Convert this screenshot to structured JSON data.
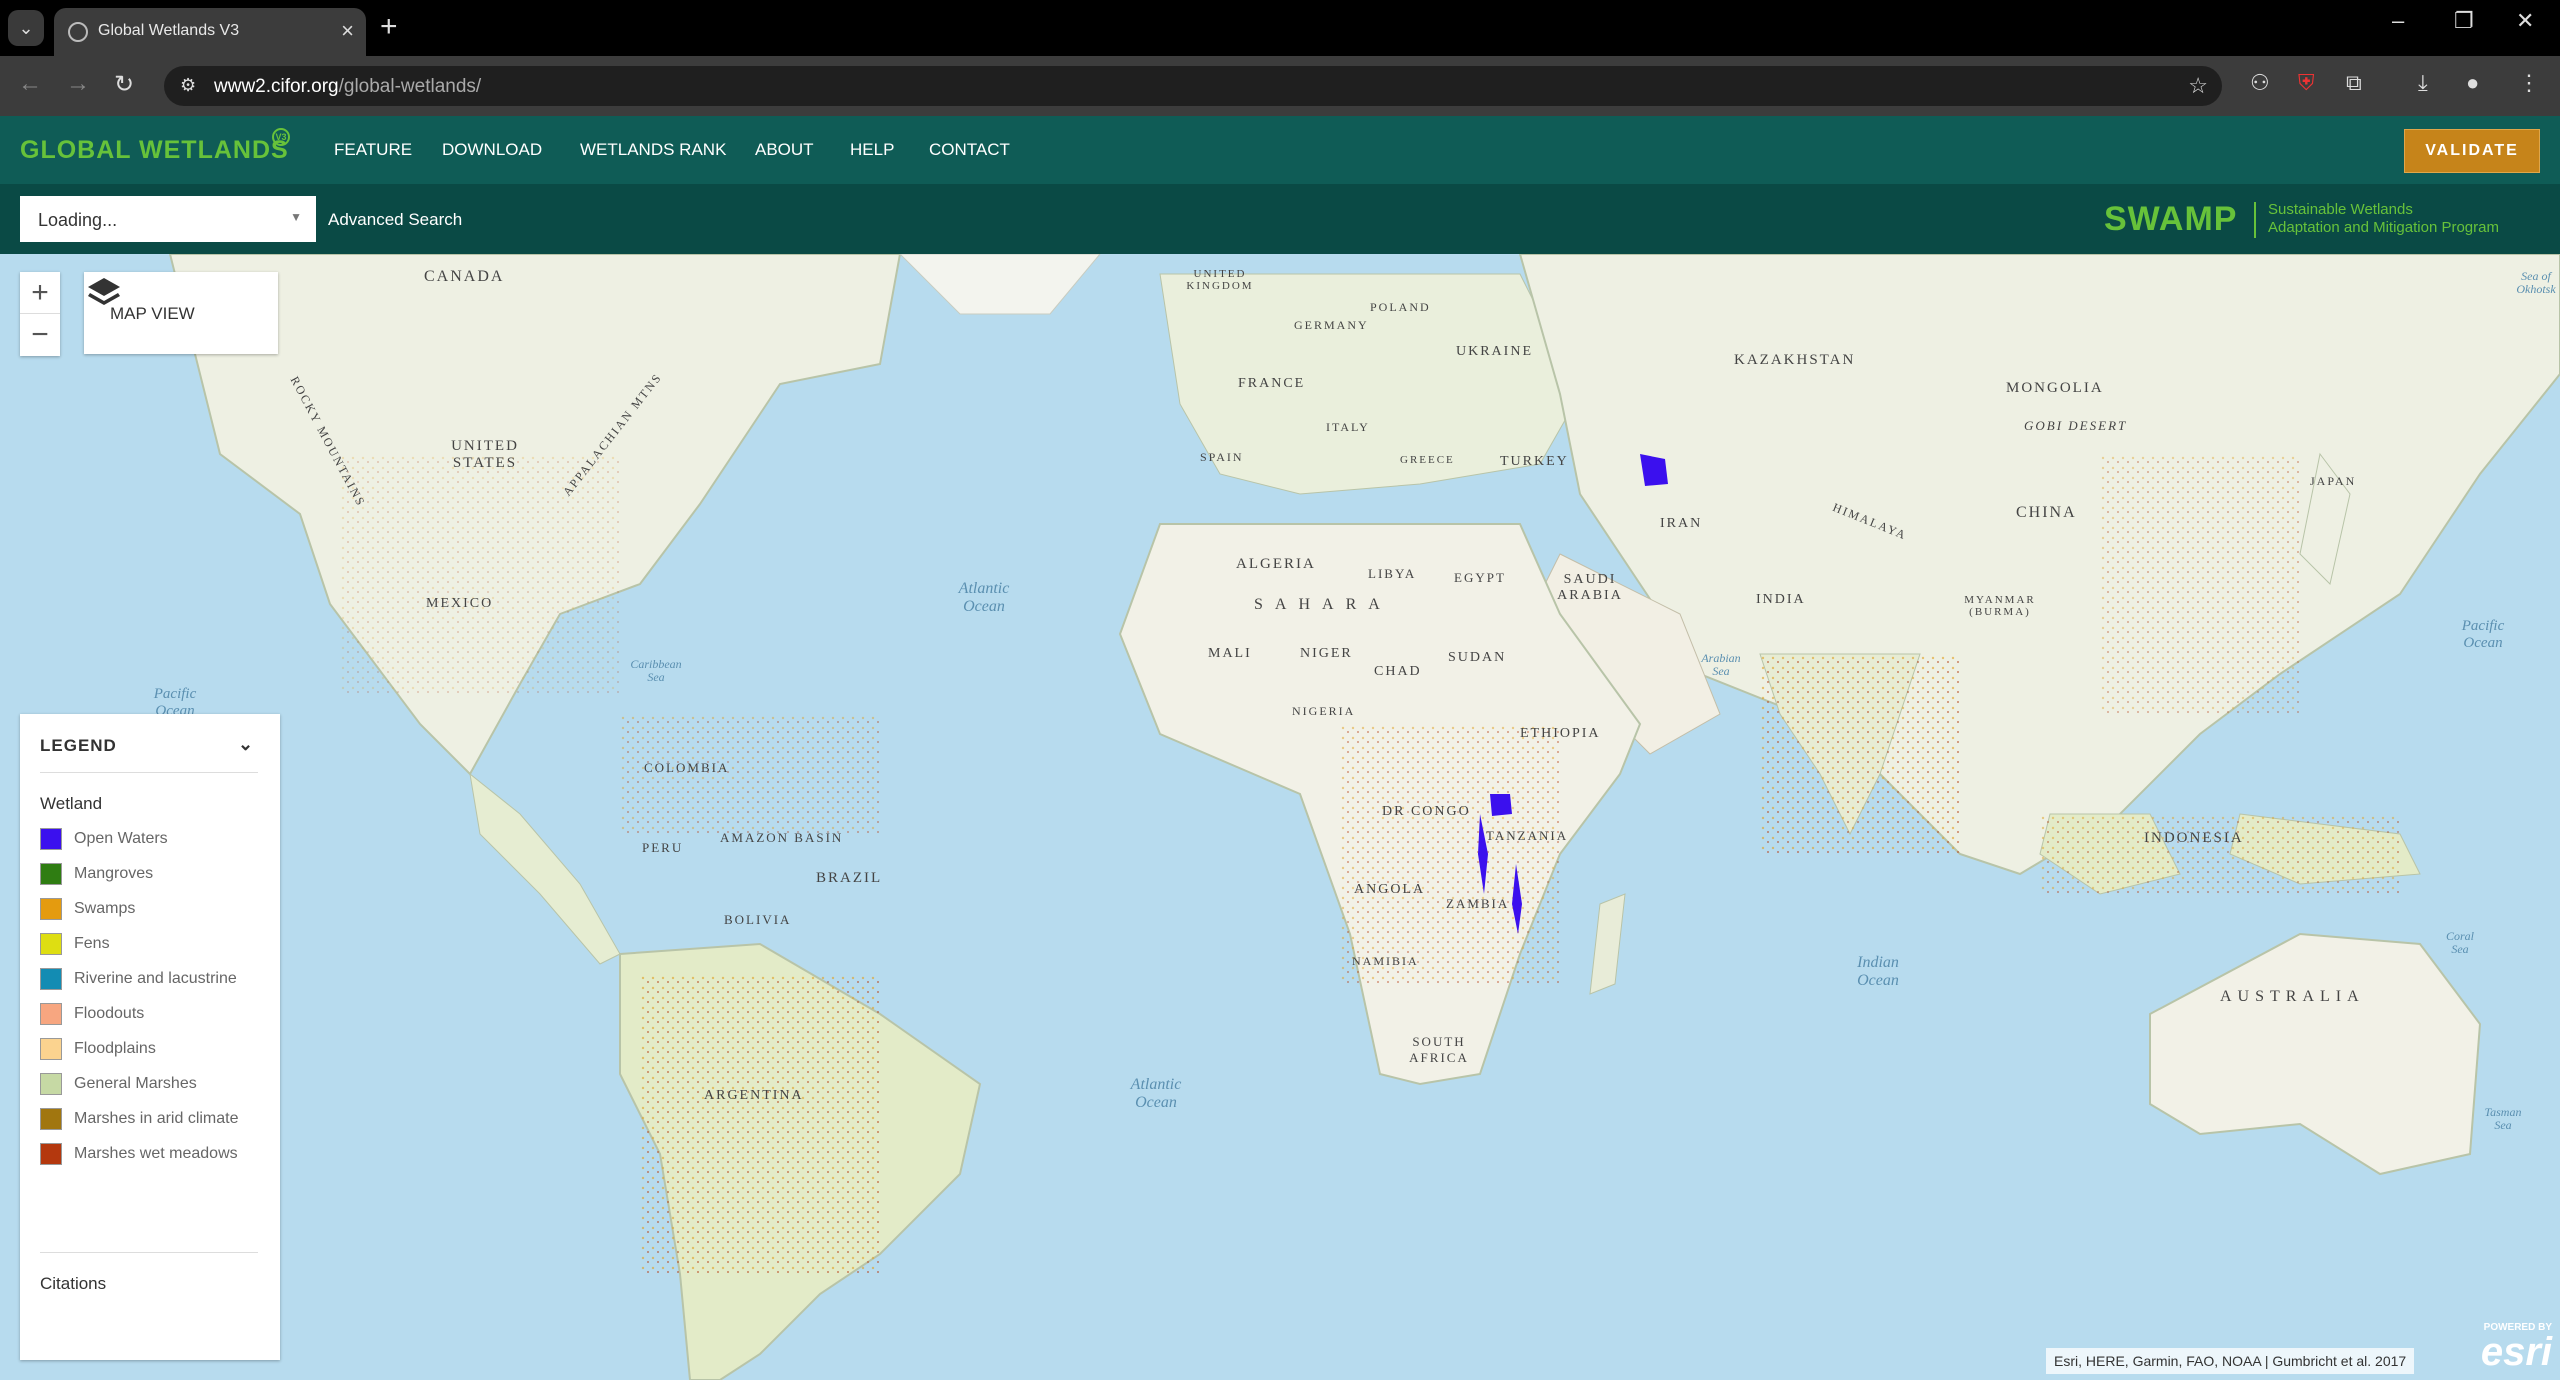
{
  "browser": {
    "tab_title": "Global Wetlands V3",
    "url_host": "www2.cifor.org",
    "url_path": "/global-wetlands/"
  },
  "header": {
    "logo": "GLOBAL WETLANDS",
    "logo_badge": "V3",
    "menu": [
      "FEATURE",
      "DOWNLOAD",
      "WETLANDS RANK",
      "ABOUT",
      "HELP",
      "CONTACT"
    ],
    "validate_label": "VALIDATE"
  },
  "search": {
    "value": "Loading...",
    "advanced_label": "Advanced Search"
  },
  "swamp": {
    "title": "SWAMP",
    "line1": "Sustainable Wetlands",
    "line2": "Adaptation and Mitigation Program"
  },
  "map": {
    "view_label": "MAP VIEW",
    "zoom_in": "+",
    "zoom_out": "−",
    "labels": [
      "CANADA",
      "UNITED STATES",
      "MEXICO",
      "COLOMBIA",
      "PERU",
      "BRAZIL",
      "AMAZON BASIN",
      "BOLIVIA",
      "ARGENTINA",
      "UNITED KINGDOM",
      "GERMANY",
      "POLAND",
      "UKRAINE",
      "FRANCE",
      "SPAIN",
      "ITALY",
      "GREECE",
      "TURKEY",
      "KAZAKHSTAN",
      "MONGOLIA",
      "GOBI DESERT",
      "CHINA",
      "JAPAN",
      "IRAN",
      "SAUDI ARABIA",
      "EGYPT",
      "LIBYA",
      "ALGERIA",
      "SAHARA",
      "MALI",
      "NIGER",
      "CHAD",
      "SUDAN",
      "NIGERIA",
      "ETHIOPIA",
      "DR CONGO",
      "TANZANIA",
      "ANGOLA",
      "ZAMBIA",
      "NAMIBIA",
      "SOUTH AFRICA",
      "INDIA",
      "MYANMAR (BURMA)",
      "INDONESIA",
      "AUSTRALIA",
      "ROCKY MOUNTAINS",
      "APPALACHIAN MTNS",
      "HIMALAYA"
    ],
    "oceans": [
      "Atlantic Ocean",
      "Atlantic Ocean",
      "Pacific Ocean",
      "Pacific Ocean",
      "Indian Ocean",
      "Sea of Okhotsk",
      "Arabian Sea",
      "Caribbean Sea",
      "Coral Sea",
      "Tasman Sea"
    ],
    "attribution": "Esri, HERE, Garmin, FAO, NOAA | Gumbricht et al. 2017",
    "powered_by": "POWERED BY",
    "esri": "esri"
  },
  "legend": {
    "title": "LEGEND",
    "group": "Wetland",
    "items": [
      {
        "label": "Open Waters",
        "color": "#3b10ee"
      },
      {
        "label": "Mangroves",
        "color": "#2f7d12"
      },
      {
        "label": "Swamps",
        "color": "#e49b0f"
      },
      {
        "label": "Fens",
        "color": "#dede12"
      },
      {
        "label": "Riverine and lacustrine",
        "color": "#138cb3"
      },
      {
        "label": "Floodouts",
        "color": "#f7a680"
      },
      {
        "label": "Floodplains",
        "color": "#fbd38f"
      },
      {
        "label": "General Marshes",
        "color": "#c6d9a4"
      },
      {
        "label": "Marshes in arid climate",
        "color": "#a1760f"
      },
      {
        "label": "Marshes wet meadows",
        "color": "#b4380e"
      }
    ],
    "citations": "Citations"
  }
}
